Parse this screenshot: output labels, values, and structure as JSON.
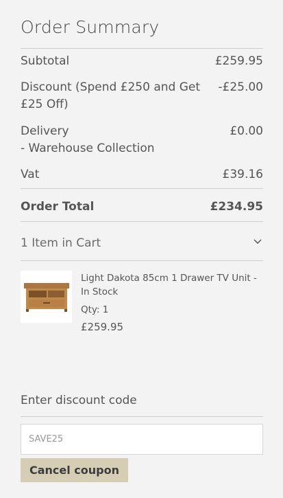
{
  "summary": {
    "title": "Order Summary",
    "subtotal_label": "Subtotal",
    "subtotal_value": "£259.95",
    "discount_label": "Discount (Spend £250 and Get £25 Off)",
    "discount_value": "-£25.00",
    "delivery_label_line1": "Delivery",
    "delivery_label_line2": "- Warehouse Collection",
    "delivery_value": "£0.00",
    "vat_label": "Vat",
    "vat_value": "£39.16",
    "total_label": "Order Total",
    "total_value": "£234.95"
  },
  "cart": {
    "toggle_label": "1 Item in Cart",
    "toggle_icon": "chevron-down-icon",
    "item": {
      "name": "Light Dakota 85cm 1 Drawer TV Unit - In Stock",
      "qty": "Qty: 1",
      "price": "£259.95",
      "image_icon": "tv-unit-thumbnail"
    }
  },
  "discount": {
    "label": "Enter discount code",
    "value": "SAVE25",
    "button_label": "Cancel coupon"
  }
}
